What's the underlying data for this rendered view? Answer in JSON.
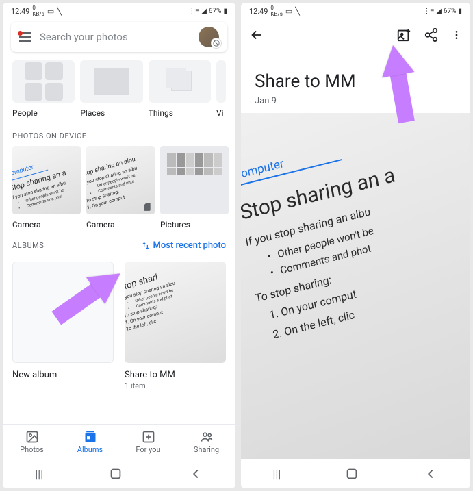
{
  "status": {
    "time": "12:49",
    "speed": "0",
    "speed_unit": "KB/s",
    "battery": "67%"
  },
  "search": {
    "placeholder": "Search your photos"
  },
  "categories": [
    {
      "label": "People"
    },
    {
      "label": "Places"
    },
    {
      "label": "Things"
    },
    {
      "label": "Vi"
    }
  ],
  "sections": {
    "device": "PHOTOS ON DEVICE",
    "albums": "ALBUMS"
  },
  "device_photos": [
    {
      "label": "Camera"
    },
    {
      "label": "Camera"
    },
    {
      "label": "Pictures"
    }
  ],
  "sort": "Most recent photo",
  "albums": [
    {
      "label": "New album",
      "sub": ""
    },
    {
      "label": "Share to MM",
      "sub": "1 item"
    }
  ],
  "nav": {
    "photos": "Photos",
    "albums": "Albums",
    "foryou": "For you",
    "sharing": "Sharing"
  },
  "album_detail": {
    "title": "Share to MM",
    "date": "Jan 9"
  },
  "doc": {
    "tab": "Computer",
    "h1": "Stop sharing an a",
    "p1": "If you stop sharing an albu",
    "li1": "Other people won't be",
    "li2": "Comments and phot",
    "p2": "To stop sharing:",
    "li3": "1. On your comput",
    "li4": "2. On the left, clic"
  }
}
